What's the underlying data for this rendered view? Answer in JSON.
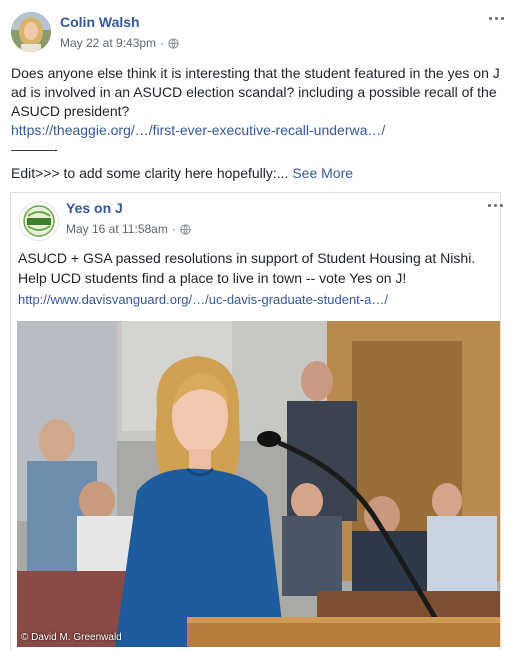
{
  "post": {
    "author": "Colin Walsh",
    "timestamp": "May 22 at 9:43pm",
    "audience_icon": "globe-icon",
    "body_text": "Does anyone else think it is interesting that the student featured in the yes on J ad is involved in an ASUCD election scandal? including a possible recall of the ASUCD president?",
    "link_text": "https://theaggie.org/…/first-ever-executive-recall-underwa…/",
    "separator": "———-",
    "edit_text": "Edit>>> to add some clarity here hopefully:...",
    "see_more": "See More"
  },
  "shared": {
    "author": "Yes on J",
    "avatar_text": "YES ON J",
    "timestamp": "May 16 at 11:58am",
    "audience_icon": "globe-icon",
    "text": "ASUCD + GSA passed resolutions in support of Student Housing at Nishi. Help UCD students find a place to live in town -- vote Yes on J!",
    "link_text": "http://www.davisvanguard.org/…/uc-davis-graduate-student-a…/",
    "photo_credit": "© David M. Greenwald"
  },
  "colors": {
    "link": "#365899",
    "meta": "#616770",
    "text": "#1d2129",
    "border": "#dddfe2",
    "sweater": "#1f5c9e"
  }
}
